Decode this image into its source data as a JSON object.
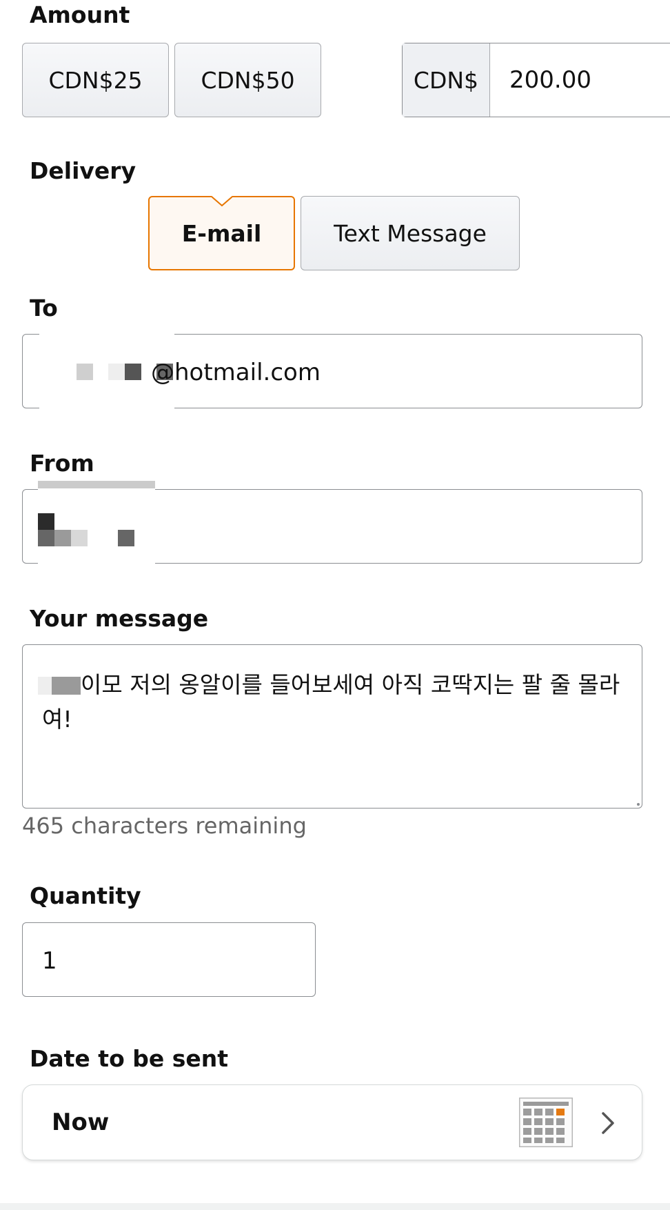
{
  "amount": {
    "label": "Amount",
    "presets": [
      "CDN$25",
      "CDN$50"
    ],
    "currency_prefix": "CDN$",
    "custom_value": "200.00"
  },
  "delivery": {
    "label": "Delivery",
    "options": [
      "E-mail",
      "Text Message"
    ],
    "selected": "E-mail"
  },
  "to": {
    "label": "To",
    "value_visible": "@hotmail.com"
  },
  "from": {
    "label": "From"
  },
  "message": {
    "label": "Your message",
    "text": "이모 저의 옹알이를 들어보세여 아직 코딱지는 팔 줄 몰라여!",
    "remaining": "465 characters remaining"
  },
  "quantity": {
    "label": "Quantity",
    "value": "1"
  },
  "send_date": {
    "label": "Date to be sent",
    "value": "Now"
  },
  "colors": {
    "selected_border": "#e77600",
    "selected_bg": "#fef8f2",
    "calendar_accent": "#e47911"
  }
}
